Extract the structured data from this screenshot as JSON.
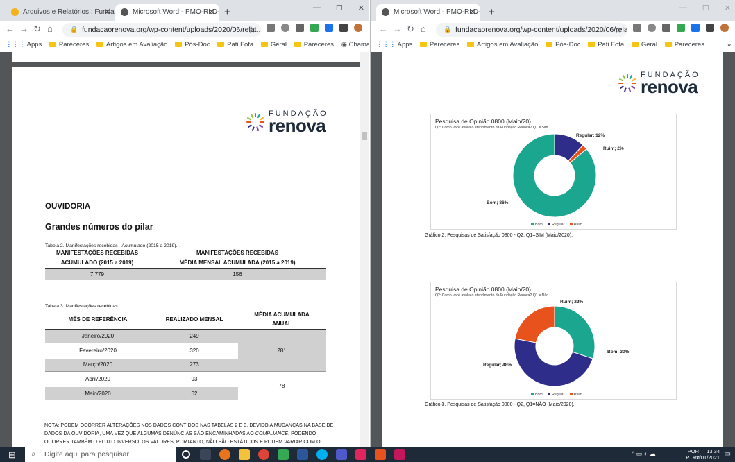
{
  "left_window": {
    "tabs": [
      {
        "label": "Arquivos e Relatórios : Fundaçã",
        "active": false
      },
      {
        "label": "Microsoft Word - PMO-RLD-001",
        "active": true
      }
    ],
    "url": "fundacaorenova.org/wp-content/uploads/2020/06/relat...",
    "bookmarks": [
      "Apps",
      "Pareceres",
      "Artigos em Avaliação",
      "Pós-Doc",
      "Pati Fofa",
      "Geral",
      "Pareceres",
      "Chamada para Edit..."
    ],
    "more": "»",
    "page": {
      "logo": {
        "top": "FUNDAÇÃO",
        "main": "renova"
      },
      "section_title": "OUVIDORIA",
      "subtitle": "Grandes números do pilar",
      "table2": {
        "caption": "Tabela 2. Manifestações recebidas - Acumulado (2015 a 2019).",
        "col1": [
          "MANIFESTAÇÕES RECEBIDAS",
          "ACUMULADO (2015 a 2019)"
        ],
        "col2": [
          "MANIFESTAÇÕES RECEBIDAS",
          "MÉDIA MENSAL ACUMULADA (2015 a 2019)"
        ],
        "v1": "7.779",
        "v2": "156"
      },
      "table3": {
        "caption": "Tabela 3. Manifestações recebidas.",
        "h1": "MÊS DE REFERÊNCIA",
        "h2": "REALIZADO MENSAL",
        "h3": [
          "MÉDIA ACUMULADA",
          "ANUAL"
        ],
        "rows": [
          {
            "month": "Janeiro/2020",
            "value": "249"
          },
          {
            "month": "Fevereiro/2020",
            "value": "320"
          },
          {
            "month": "Março/2020",
            "value": "273"
          },
          {
            "month": "Abril/2020",
            "value": "93"
          },
          {
            "month": "Maio/2020",
            "value": "62"
          }
        ],
        "avg1": "281",
        "avg2": "78"
      },
      "note_parts": [
        "NOTA: PODEM OCORRER ALTERAÇÕES NOS DADOS CONTIDOS NAS TABELAS 2 E 3, DEVIDO A MUDANÇAS NA BASE DE DADOS DA OUVIDORIA, UMA VEZ QUE ALGUMAS DENÚNCIAS SÃO ENCAMINHADAS AO ",
        "COMPLIANCE",
        ", PODENDO OCORRER TAMBÉM O FLUXO INVERSO. OS VALORES, PORTANTO, NÃO SÃO ESTÁTICOS E PODEM VARIAR COM O PASSAR DOS MESES."
      ]
    }
  },
  "right_window": {
    "tab": "Microsoft Word - PMO-RLD-001",
    "url": "fundacaorenova.org/wp-content/uploads/2020/06/relat...",
    "bookmarks": [
      "Apps",
      "Pareceres",
      "Artigos em Avaliação",
      "Pós-Doc",
      "Pati Fofa",
      "Geral",
      "Pareceres"
    ],
    "more": "»",
    "logo": {
      "top": "FUNDAÇÃO",
      "main": "renova"
    },
    "chart1_caption": "Gráfico 2. Pesquisas de Satisfação 0800 - Q2, Q1=SIM (Maio/2020).",
    "chart2_caption": "Gráfico 3. Pesquisas de Satisfação 0800 - Q2, Q1=NÃO (Maio/2020)."
  },
  "taskbar": {
    "search_placeholder": "Digite aqui para pesquisar",
    "lang": "POR",
    "kbd": "PTB2",
    "time": "13:34",
    "date": "20/01/2021"
  },
  "colors": {
    "bom": "#1aa68f",
    "regular": "#2e2e8a",
    "ruim": "#e8521d"
  },
  "chart_data": [
    {
      "type": "pie",
      "title": "Pesquisa de Opinião 0800 (Maio/20)",
      "subtitle": "Q2: Como você avalia o atendimento da Fundação Renova? Q1 = Sim",
      "categories": [
        "Bom",
        "Regular",
        "Ruim"
      ],
      "values": [
        86,
        12,
        2
      ],
      "data_labels": [
        "Bom; 86%",
        "Regular; 12%",
        "Ruim; 2%"
      ],
      "legend": "bottom"
    },
    {
      "type": "pie",
      "title": "Pesquisa de Opinião 0800 (Maio/20)",
      "subtitle": "Q2: Como você avalia o atendimento da Fundação Renova? Q1 = Não",
      "categories": [
        "Bom",
        "Regular",
        "Ruim"
      ],
      "values": [
        30,
        48,
        22
      ],
      "data_labels": [
        "Bom; 30%",
        "Regular; 48%",
        "Ruim; 22%"
      ],
      "legend": "bottom"
    }
  ]
}
